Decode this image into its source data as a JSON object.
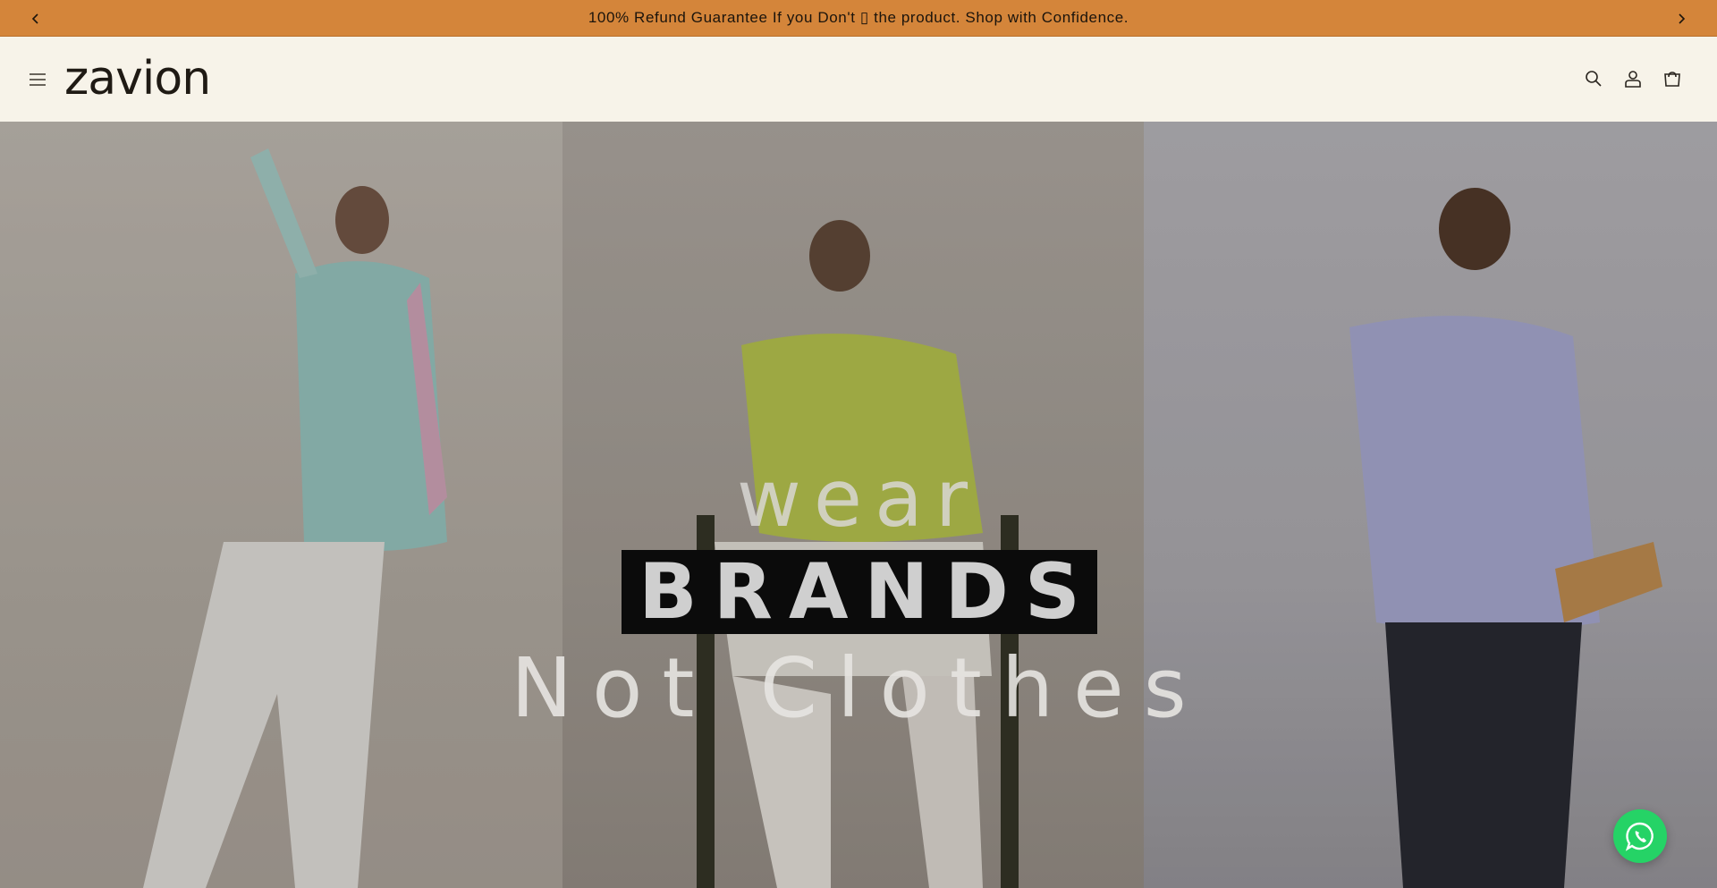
{
  "announcement": {
    "text": "100% Refund Guarantee If you Don't ▯ the product. Shop with Confidence.",
    "prev_icon": "chevron-left-icon",
    "next_icon": "chevron-right-icon",
    "background": "#d4853a"
  },
  "header": {
    "logo_text": "zavion",
    "menu_icon": "hamburger-menu-icon",
    "icons": [
      "search-icon",
      "account-icon",
      "cart-icon"
    ],
    "background": "#f7f3e9"
  },
  "hero": {
    "line1": "wear",
    "line2": "BRANDS",
    "line3": "Not Clothes"
  },
  "floating": {
    "whatsapp_icon": "whatsapp-icon",
    "color": "#25d366"
  }
}
